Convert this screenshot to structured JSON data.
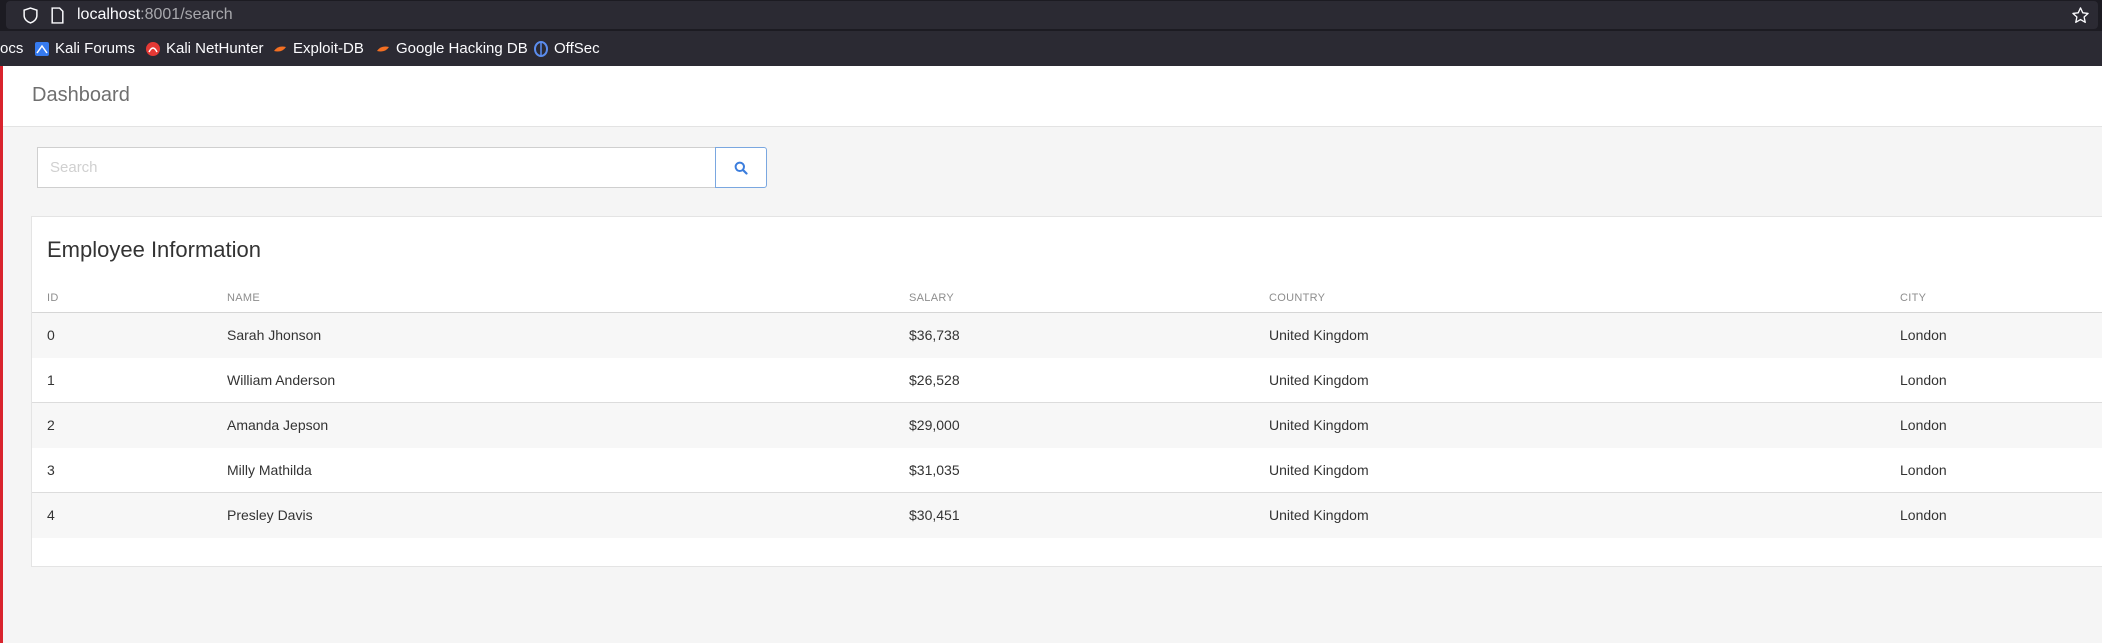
{
  "browser": {
    "url_host": "localhost",
    "url_rest": ":8001/search",
    "bookmarks": [
      {
        "label": "ocs",
        "icon": "none"
      },
      {
        "label": "Kali Forums",
        "icon": "kali-forums-icon"
      },
      {
        "label": "Kali NetHunter",
        "icon": "kali-nethunter-icon"
      },
      {
        "label": "Exploit-DB",
        "icon": "exploit-db-icon"
      },
      {
        "label": "Google Hacking DB",
        "icon": "google-hacking-db-icon"
      },
      {
        "label": "OffSec",
        "icon": "offsec-icon"
      }
    ]
  },
  "page": {
    "title": "Dashboard",
    "search": {
      "placeholder": "Search",
      "value": ""
    },
    "table": {
      "title": "Employee Information",
      "columns": [
        "ID",
        "NAME",
        "SALARY",
        "COUNTRY",
        "CITY"
      ],
      "rows": [
        {
          "id": "0",
          "name": "Sarah Jhonson",
          "salary": "$36,738",
          "country": "United Kingdom",
          "city": "London"
        },
        {
          "id": "1",
          "name": "William Anderson",
          "salary": "$26,528",
          "country": "United Kingdom",
          "city": "London"
        },
        {
          "id": "2",
          "name": "Amanda Jepson",
          "salary": "$29,000",
          "country": "United Kingdom",
          "city": "London"
        },
        {
          "id": "3",
          "name": "Milly Mathilda",
          "salary": "$31,035",
          "country": "United Kingdom",
          "city": "London"
        },
        {
          "id": "4",
          "name": "Presley Davis",
          "salary": "$30,451",
          "country": "United Kingdom",
          "city": "London"
        }
      ]
    }
  },
  "colors": {
    "accent": "#d9232d",
    "search_button_border": "#7aa7e0",
    "chrome_dark": "#2b2a33"
  }
}
